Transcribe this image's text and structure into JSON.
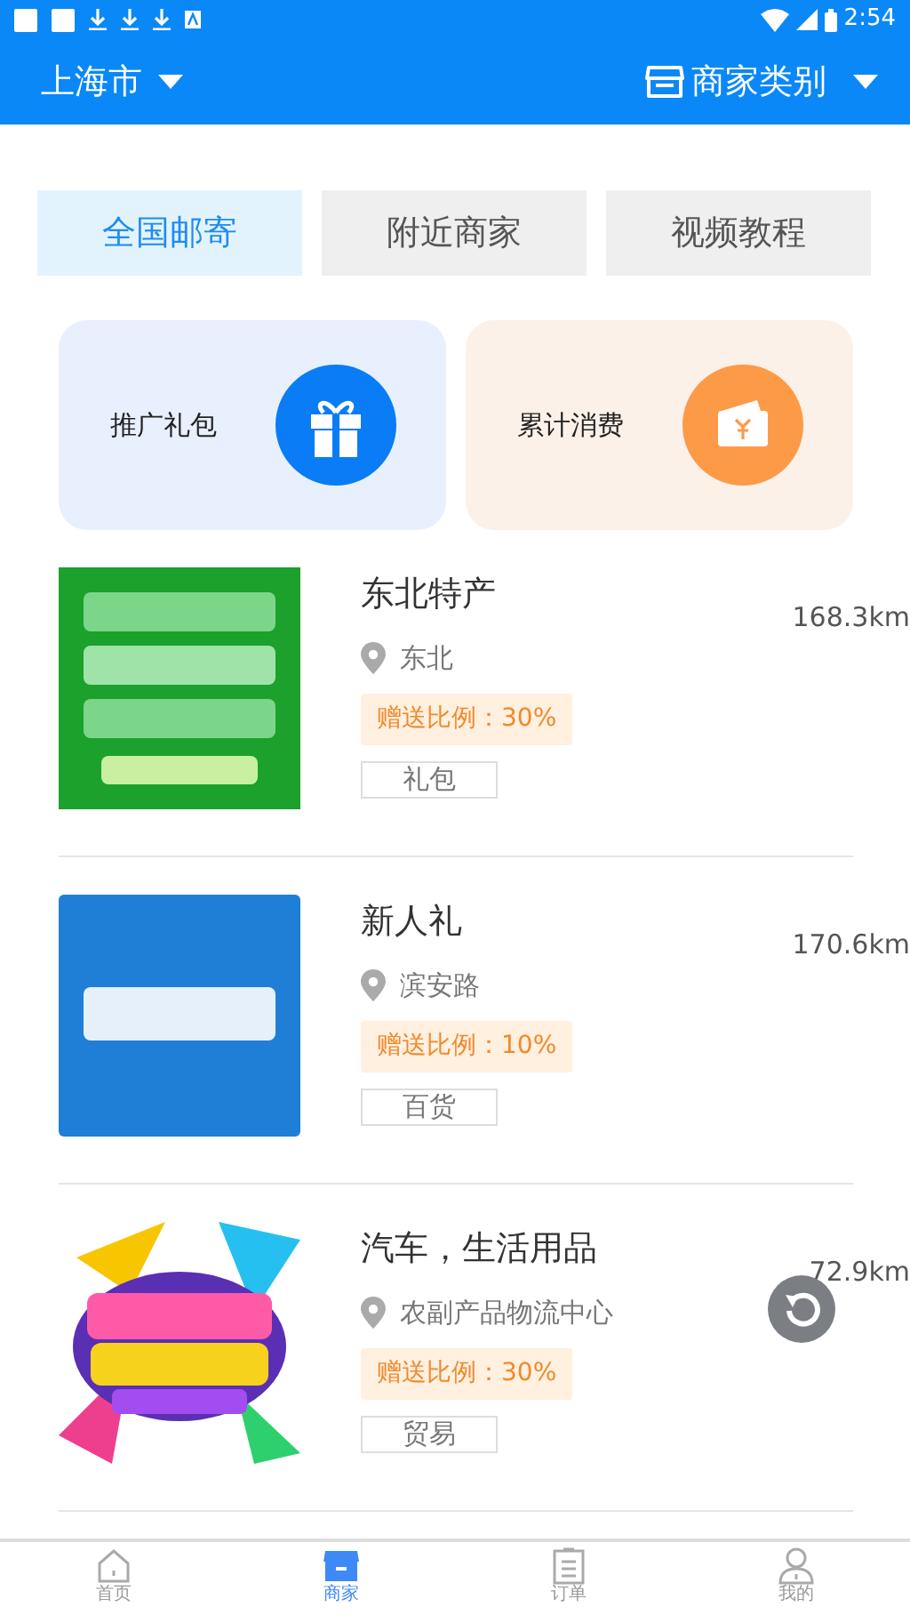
{
  "status_bar": {
    "time": "2:54"
  },
  "header": {
    "city": "上海市",
    "category": "商家类别"
  },
  "tabs": [
    {
      "label": "全国邮寄",
      "selected": true
    },
    {
      "label": "附近商家",
      "selected": false
    },
    {
      "label": "视频教程",
      "selected": false
    }
  ],
  "promo_cards": [
    {
      "label": "推广礼包",
      "kind": "gift"
    },
    {
      "label": "累计消费",
      "kind": "wallet"
    }
  ],
  "merchants": [
    {
      "name": "东北特产",
      "location": "东北",
      "ratio": "赠送比例：30%",
      "tag": "礼包",
      "distance": "168.3km"
    },
    {
      "name": "新人礼",
      "location": "滨安路",
      "ratio": "赠送比例：10%",
      "tag": "百货",
      "distance": "170.6km"
    },
    {
      "name": "汽车，生活用品",
      "location": "农副产品物流中心",
      "ratio": "赠送比例：30%",
      "tag": "贸易",
      "distance": "72.9km"
    }
  ],
  "bottom_nav": [
    {
      "label": "首页",
      "kind": "home",
      "selected": false
    },
    {
      "label": "商家",
      "kind": "shop",
      "selected": true
    },
    {
      "label": "订单",
      "kind": "orders",
      "selected": false
    },
    {
      "label": "我的",
      "kind": "profile",
      "selected": false
    }
  ]
}
